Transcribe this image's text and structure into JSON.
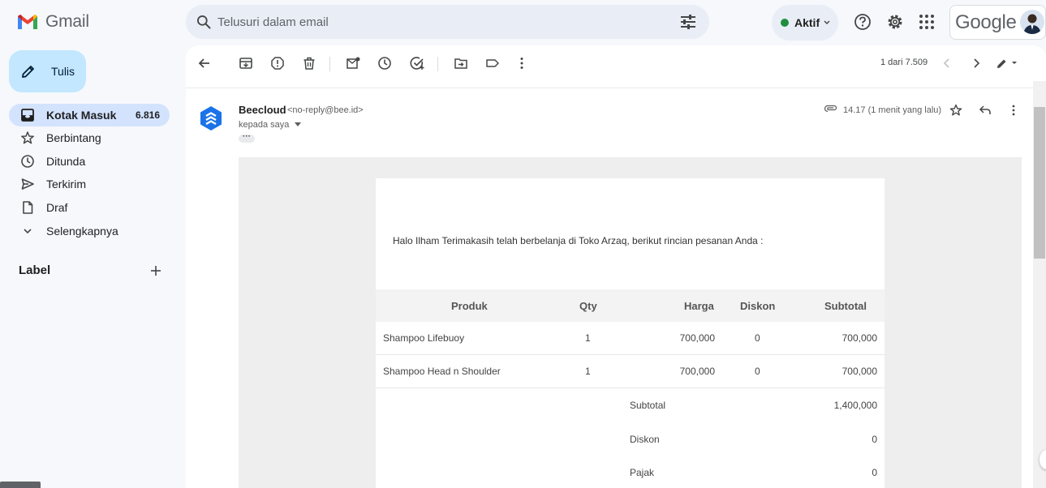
{
  "app": {
    "name": "Gmail"
  },
  "search": {
    "placeholder": "Telusuri dalam email"
  },
  "status": {
    "label": "Aktif"
  },
  "account": {
    "brand": "Google"
  },
  "compose": {
    "label": "Tulis"
  },
  "sidebar": {
    "items": [
      {
        "label": "Kotak Masuk",
        "count": "6.816",
        "icon": "inbox-icon"
      },
      {
        "label": "Berbintang",
        "count": "",
        "icon": "star-icon"
      },
      {
        "label": "Ditunda",
        "count": "",
        "icon": "clock-icon"
      },
      {
        "label": "Terkirim",
        "count": "",
        "icon": "send-icon"
      },
      {
        "label": "Draf",
        "count": "",
        "icon": "file-icon"
      },
      {
        "label": "Selengkapnya",
        "count": "",
        "icon": "chevron-down-icon"
      }
    ],
    "label_section": "Label"
  },
  "toolbar": {
    "pager": "1 dari 7.509"
  },
  "message": {
    "sender_name": "Beecloud",
    "sender_email": "<no-reply@bee.id>",
    "recipient": "kepada saya",
    "time": "14.17 (1 menit yang lalu)"
  },
  "email": {
    "greeting": "Halo Ilham Terimakasih telah berbelanja di Toko Arzaq, berikut rincian pesanan Anda :",
    "headers": {
      "product": "Produk",
      "qty": "Qty",
      "price": "Harga",
      "discount": "Diskon",
      "subtotal": "Subtotal"
    },
    "rows": [
      {
        "product": "Shampoo Lifebuoy",
        "qty": "1",
        "price": "700,000",
        "discount": "0",
        "subtotal": "700,000"
      },
      {
        "product": "Shampoo Head n Shoulder",
        "qty": "1",
        "price": "700,000",
        "discount": "0",
        "subtotal": "700,000"
      }
    ],
    "summary": [
      {
        "label": "Subtotal",
        "value": "1,400,000"
      },
      {
        "label": "Diskon",
        "value": "0"
      },
      {
        "label": "Pajak",
        "value": "0"
      }
    ]
  },
  "colors": {
    "accent": "#c2e7ff",
    "active_nav": "#d3e3fd",
    "status_green": "#1e8e3e",
    "brand_blue": "#1a73e8"
  }
}
